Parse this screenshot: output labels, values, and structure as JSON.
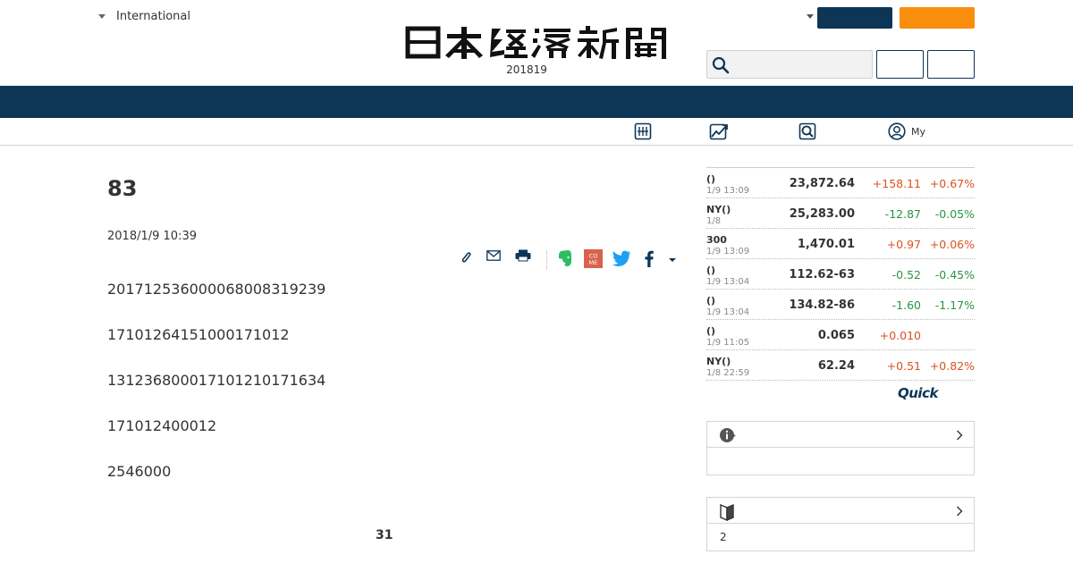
{
  "header": {
    "edition_label": "International",
    "logo_alt": "日本経済新聞",
    "date": "201819",
    "search": {
      "value": "",
      "placeholder": ""
    },
    "colors": {
      "navy": "#0d3556",
      "orange": "#f98e0d"
    }
  },
  "subnav": {
    "items": [
      {
        "icon": "newspaper-icon",
        "label": ""
      },
      {
        "icon": "market-chart-icon",
        "label": ""
      },
      {
        "icon": "search-doc-icon",
        "label": ""
      },
      {
        "icon": "user-circle-icon",
        "label": "My"
      }
    ]
  },
  "article": {
    "headline": "83",
    "timestamp": "2018/1/9 10:39",
    "share_icons": [
      "clip-icon",
      "mail-icon",
      "print-icon",
      "evernote-icon",
      "come-icon",
      "twitter-icon",
      "facebook-icon",
      "more-caret-icon"
    ],
    "come_text": "COME",
    "paragraphs": [
      "201712536000068008319239",
      "17101264151000171012",
      "1312368000171012101716​34",
      "171012400012",
      "2546000"
    ],
    "pager": "31"
  },
  "market": {
    "rows": [
      {
        "name": "()",
        "time": "1/9 13:09",
        "price": "23,872.64",
        "change": "+158.11",
        "percent": "+0.67%",
        "dir": "up"
      },
      {
        "name": "NY()",
        "time": "1/8",
        "price": "25,283.00",
        "change": "-12.87",
        "percent": "-0.05%",
        "dir": "down"
      },
      {
        "name": "300",
        "time": "1/9 13:09",
        "price": "1,470.01",
        "change": "+0.97",
        "percent": "+0.06%",
        "dir": "up"
      },
      {
        "name": "()",
        "time": "1/9 13:04",
        "price": "112.62-63",
        "change": "-0.52",
        "percent": "-0.45%",
        "dir": "down"
      },
      {
        "name": "()",
        "time": "1/9 13:04",
        "price": "134.82-86",
        "change": "-1.60",
        "percent": "-1.17%",
        "dir": "down"
      },
      {
        "name": "()",
        "time": "1/9 11:05",
        "price": "0.065",
        "change": "+0.010",
        "percent": "",
        "dir": "up"
      },
      {
        "name": "NY()",
        "time": "1/8 22:59",
        "price": "62.24",
        "change": "+0.51",
        "percent": "+0.82%",
        "dir": "up"
      }
    ],
    "provider": "Quick",
    "colors": {
      "up": "#d9531e",
      "down": "#279544"
    }
  },
  "side_boxes": [
    {
      "icon": "info-icon",
      "title": "",
      "body": ""
    },
    {
      "icon": "beginner-mark-icon",
      "title": "",
      "body": "2"
    }
  ]
}
